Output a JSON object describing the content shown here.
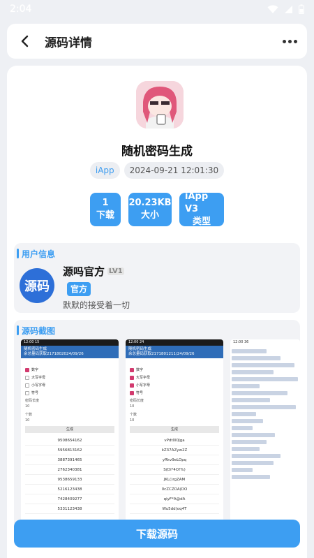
{
  "status_bar": {
    "time": "2:04"
  },
  "header": {
    "title": "源码详情"
  },
  "app": {
    "name": "随机密码生成",
    "language": "iApp",
    "date": "2024-09-21 12:01:30",
    "stats": [
      {
        "value": "1",
        "label": "下载"
      },
      {
        "value": "20.23KB",
        "label": "大小"
      },
      {
        "value": "iApp V3",
        "label": "类型"
      }
    ]
  },
  "user_section": {
    "title": "用户信息",
    "avatar_text": "源码",
    "name": "源吗官方",
    "level": "LV1",
    "badge": "官方",
    "bio": "默默的接受着一切"
  },
  "screenshots_section": {
    "title": "源码截图",
    "shots": [
      {
        "time": "12:00 15",
        "app_title": "随机密码生成",
        "sub": "余总量码获取2171802024/09/26",
        "options": [
          "数字",
          "大写字母",
          "小写字母",
          "符号"
        ],
        "len_label": "密码长度",
        "len_value": "10",
        "count_label": "个数",
        "count_value": "10",
        "generate_label": "生成",
        "results": [
          "9508654162",
          "5956813162",
          "3887391465",
          "2762340381",
          "9538659133",
          "5216123438",
          "7428409277",
          "5331123438"
        ]
      },
      {
        "time": "12:00 24",
        "app_title": "随机密码生成",
        "sub": "余总量码获取2171801211/24/09/26",
        "options": [
          "数字",
          "大写字母",
          "小写字母",
          "符号"
        ],
        "len_label": "密码长度",
        "len_value": "10",
        "count_label": "个数",
        "count_value": "10",
        "generate_label": "生成",
        "results": [
          "vPdt0I0Jga",
          "kZ37AZyw2Z",
          "yRkv9eLOpq",
          "S(Di*4O!%)",
          "JKL()rgZAM",
          "0cZCZOA(DO",
          "qiyF*A@dA",
          "Wu5dd)oq4T"
        ]
      },
      {
        "time": "12:00 36"
      }
    ]
  },
  "download_button": {
    "label": "下载源码"
  }
}
